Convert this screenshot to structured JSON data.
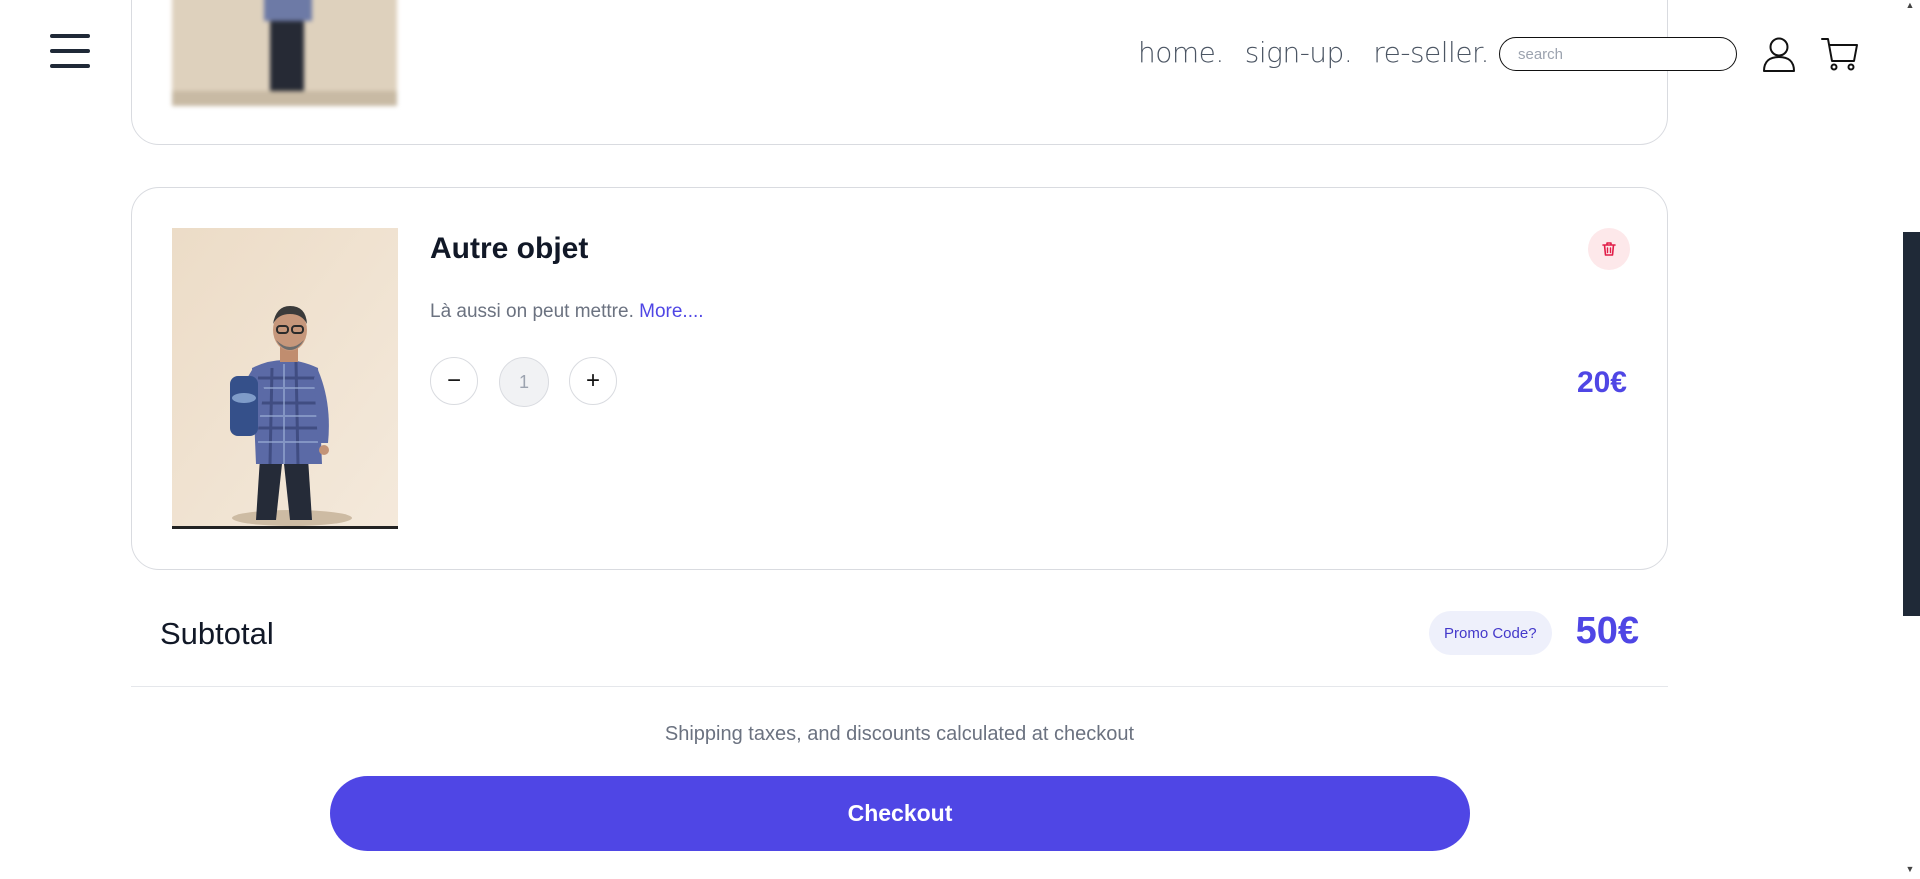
{
  "header": {
    "nav": [
      "home.",
      "sign-up.",
      "re-seller."
    ],
    "search_placeholder": "search",
    "icons": [
      "menu-icon",
      "user-icon",
      "cart-icon"
    ]
  },
  "cart": {
    "item": {
      "title": "Autre objet",
      "description": "Là aussi on peut mettre.",
      "more_link": "More....",
      "decrement": "−",
      "quantity": "1",
      "increment": "+",
      "price": "20€",
      "delete_icon": "trash-icon"
    },
    "subtotal_label": "Subtotal",
    "promo_label": "Promo Code?",
    "subtotal_value": "50€",
    "shipping_note": "Shipping taxes, and discounts calculated at checkout",
    "checkout_label": "Checkout"
  },
  "colors": {
    "accent": "#4f46e5",
    "delete_bg": "#fde8ea",
    "delete_icon": "#e11d48",
    "text_dark": "#111827",
    "text_muted": "#6b7280"
  }
}
